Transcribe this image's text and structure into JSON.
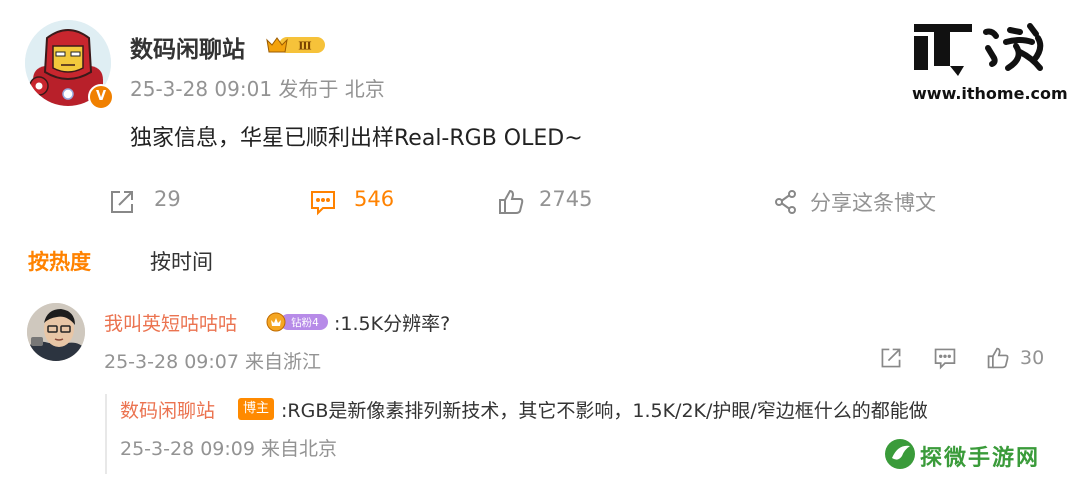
{
  "post": {
    "username": "数码闲聊站",
    "member_level": "Ⅲ",
    "verified_badge": "V",
    "timestamp": "25-3-28 09:01",
    "source": "发布于 北京",
    "text": "独家信息，华星已顺利出样Real-RGB OLED~"
  },
  "actions": {
    "repost_count": "29",
    "comment_count": "546",
    "like_count": "2745",
    "share_label": "分享这条博文"
  },
  "tabs": {
    "hot": "按热度",
    "time": "按时间"
  },
  "comment": {
    "username": "我叫英短咕咕咕",
    "fan_badge": "钻粉4",
    "text": ":1.5K分辨率?",
    "timestamp": "25-3-28 09:07",
    "source": "来自浙江",
    "like_count": "30"
  },
  "reply": {
    "username": "数码闲聊站",
    "host_badge": "博主",
    "text": ":RGB是新像素排列新技术，其它不影响，1.5K/2K/护眼/窄边框什么的都能做",
    "timestamp": "25-3-28 09:09",
    "source": "来自北京"
  },
  "watermarks": {
    "ithome_logo_text": "IT之家",
    "ithome_url": "www.ithome.com",
    "tanwei_text": "探微手游网"
  },
  "colors": {
    "accent_orange": "#ff8200",
    "username_red": "#eb7350",
    "meta_grey": "#939393"
  }
}
